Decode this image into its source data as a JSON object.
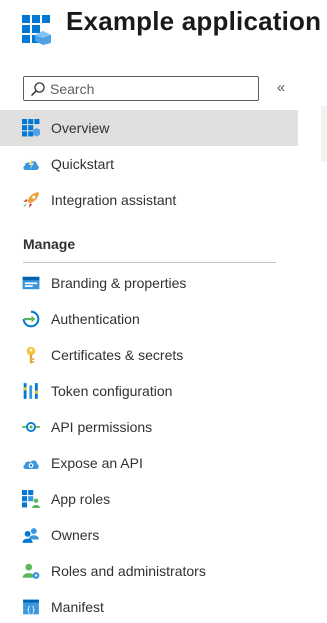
{
  "app": {
    "title": "Example application"
  },
  "search": {
    "placeholder": "Search",
    "collapse_glyph": "«"
  },
  "nav": [
    {
      "label": "Overview",
      "icon": "overview-grid-icon",
      "selected": true
    },
    {
      "label": "Quickstart",
      "icon": "quickstart-cloud-icon"
    },
    {
      "label": "Integration assistant",
      "icon": "rocket-icon"
    }
  ],
  "manage": {
    "title": "Manage",
    "items": [
      {
        "label": "Branding & properties",
        "icon": "branding-icon"
      },
      {
        "label": "Authentication",
        "icon": "authentication-icon"
      },
      {
        "label": "Certificates & secrets",
        "icon": "key-icon"
      },
      {
        "label": "Token configuration",
        "icon": "token-bars-icon"
      },
      {
        "label": "API permissions",
        "icon": "api-permissions-icon"
      },
      {
        "label": "Expose an API",
        "icon": "expose-api-cloud-icon"
      },
      {
        "label": "App roles",
        "icon": "app-roles-icon"
      },
      {
        "label": "Owners",
        "icon": "owners-icon"
      },
      {
        "label": "Roles and administrators",
        "icon": "roles-admin-icon"
      },
      {
        "label": "Manifest",
        "icon": "manifest-icon"
      }
    ]
  },
  "colors": {
    "accent": "#0078d4",
    "selected_bg": "#e1dfdd",
    "text": "#323130"
  }
}
